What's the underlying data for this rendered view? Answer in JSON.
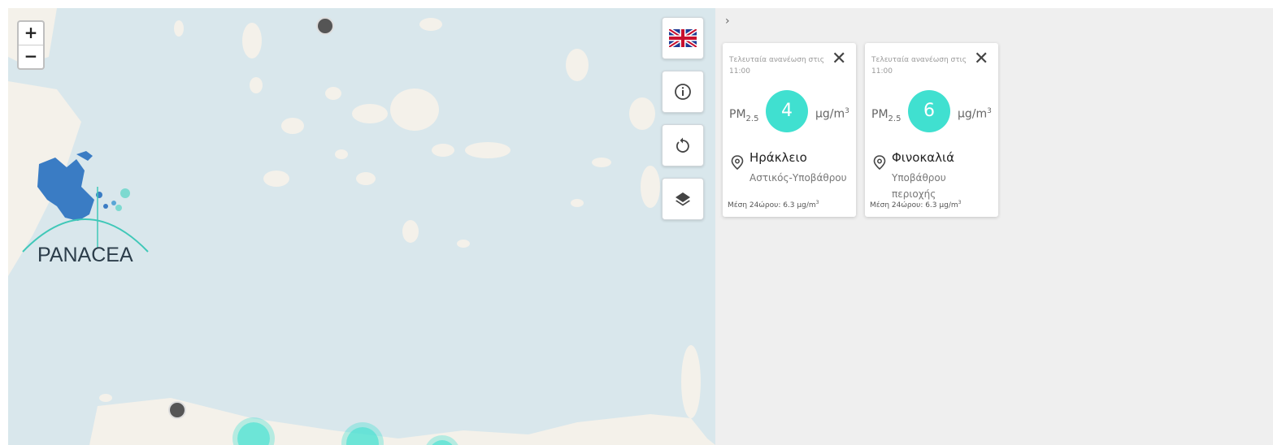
{
  "map": {
    "zoom_in": "+",
    "zoom_out": "−",
    "logo_text": "PANACEA",
    "controls": [
      {
        "name": "language-uk-flag-icon"
      },
      {
        "name": "info-icon"
      },
      {
        "name": "refresh-icon"
      },
      {
        "name": "layers-icon"
      }
    ]
  },
  "panel": {
    "toggle": "›",
    "cards": [
      {
        "updated": "Τελευταία ανανέωση στις 11:00",
        "close": "✕",
        "pm_label": "PM",
        "pm_sub": "2.5",
        "value": "4",
        "unit": "μg/m",
        "unit_sup": "3",
        "station": "Ηράκλειο",
        "type": "Αστικός-Υποβάθρου",
        "avg": "Μέση 24ώρου: 6.3 μg/m",
        "avg_sup": "3"
      },
      {
        "updated": "Τελευταία ανανέωση στις 11:00",
        "close": "✕",
        "pm_label": "PM",
        "pm_sub": "2.5",
        "value": "6",
        "unit": "μg/m",
        "unit_sup": "3",
        "station": "Φινοκαλιά",
        "type": "Υποβάθρου περιοχής",
        "avg": "Μέση 24ώρου: 6.3 μg/m",
        "avg_sup": "3"
      }
    ]
  },
  "colors": {
    "sea": "#d9e7ec",
    "land": "#f4f1ea",
    "accent": "#40e0d0",
    "greece": "#3a7cc4",
    "panel_bg": "#efefef"
  }
}
